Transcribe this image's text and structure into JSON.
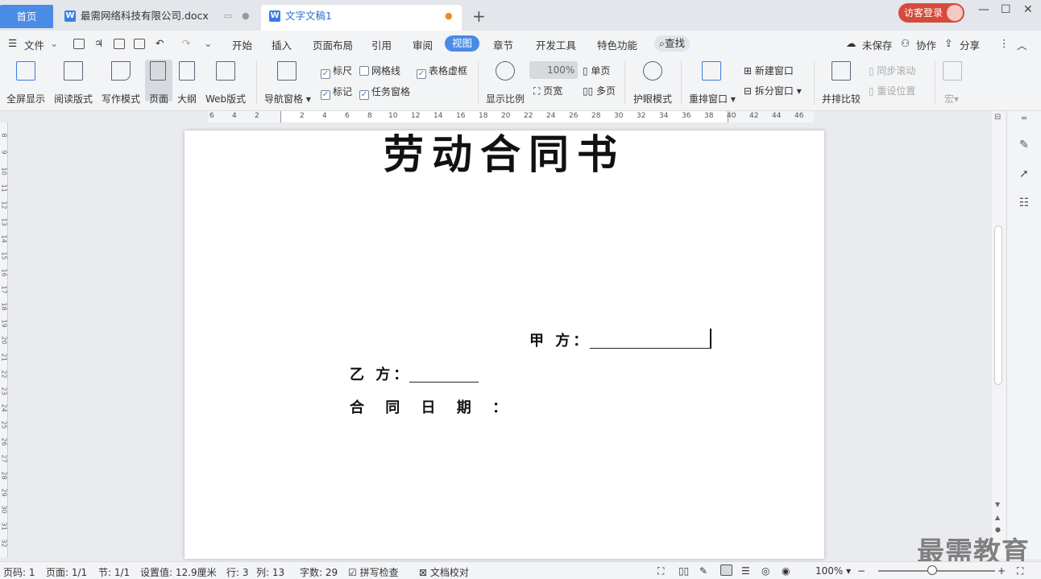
{
  "tabs": {
    "home": "首页",
    "doc1": "最需网络科技有限公司.docx",
    "doc2": "文字文稿1"
  },
  "header": {
    "login": "访客登录"
  },
  "menu": {
    "file": "文件",
    "items": [
      "开始",
      "插入",
      "页面布局",
      "引用",
      "审阅",
      "视图",
      "章节",
      "开发工具",
      "特色功能"
    ],
    "search": "查找",
    "unsaved": "未保存",
    "collab": "协作",
    "share": "分享"
  },
  "ribbon": {
    "fullscreen": "全屏显示",
    "reading": "阅读版式",
    "writing": "写作模式",
    "page": "页面",
    "outline": "大纲",
    "web": "Web版式",
    "nav": "导航窗格",
    "ruler": "标尺",
    "gridline": "网格线",
    "table_border": "表格虚框",
    "mark": "标记",
    "task_pane": "任务窗格",
    "zoom": "显示比例",
    "zoom_value": "100%",
    "page_width": "页宽",
    "single_page": "单页",
    "multi_page": "多页",
    "eye_mode": "护眼模式",
    "rearrange": "重排窗口",
    "new_window": "新建窗口",
    "split_window": "拆分窗口",
    "side_by_side": "并排比较",
    "sync_scroll": "同步滚动",
    "reset_pos": "重设位置",
    "macro": "宏"
  },
  "ruler_ticks": [
    "6",
    "4",
    "2",
    "2",
    "4",
    "6",
    "8",
    "10",
    "12",
    "14",
    "16",
    "18",
    "20",
    "22",
    "24",
    "26",
    "28",
    "30",
    "32",
    "34",
    "36",
    "38",
    "40",
    "42",
    "44",
    "46"
  ],
  "vruler_ticks": [
    "8",
    "9",
    "10",
    "11",
    "12",
    "13",
    "14",
    "15",
    "16",
    "17",
    "18",
    "19",
    "20",
    "21",
    "22",
    "23",
    "24",
    "25",
    "26",
    "27",
    "28",
    "29",
    "30",
    "31",
    "32"
  ],
  "document": {
    "title": "劳动合同书",
    "party_a": "甲 方：",
    "party_b": "乙 方：",
    "contract_date": "合 同 日 期 ："
  },
  "status": {
    "page_code": "页码: 1",
    "page": "页面: 1/1",
    "section": "节: 1/1",
    "setting": "设置值: 12.9厘米",
    "row": "行: 3",
    "col": "列: 13",
    "words": "字数: 29",
    "spellcheck": "拼写检查",
    "proofread": "文档校对",
    "zoom": "100%"
  },
  "watermark": "最需教育"
}
